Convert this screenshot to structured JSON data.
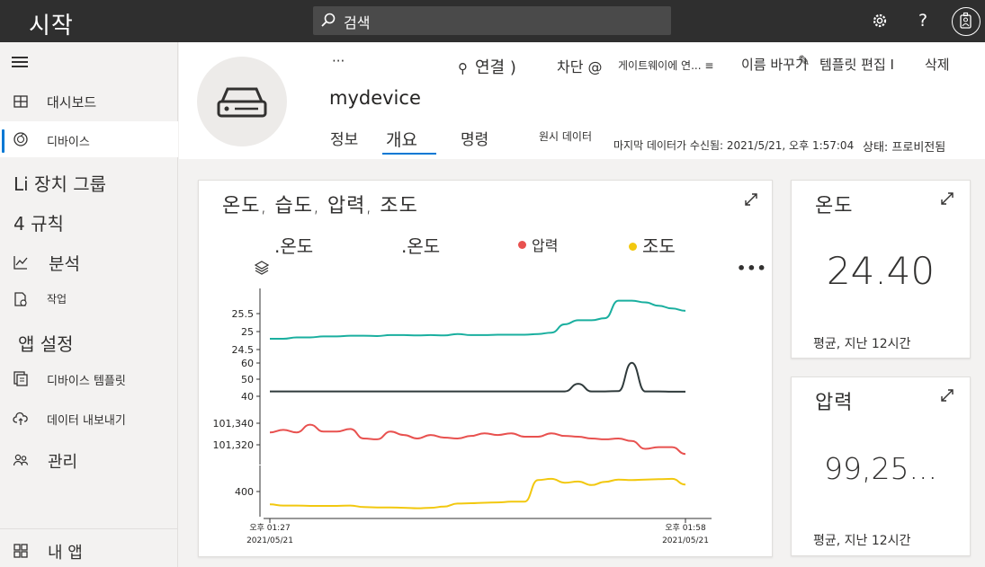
{
  "app": {
    "title": "시작"
  },
  "search": {
    "placeholder": "검색"
  },
  "sidebar": {
    "items": [
      {
        "label": "대시보드"
      },
      {
        "label": "디바이스"
      },
      {
        "label": "Li 장치 그룹"
      },
      {
        "label": "4 규칙"
      },
      {
        "label": "분석"
      },
      {
        "label": "작업"
      },
      {
        "label": "앱 설정"
      },
      {
        "label": "디바이스 템플릿"
      },
      {
        "label": "데이터 내보내기"
      },
      {
        "label": "관리"
      },
      {
        "label": "내 앱"
      }
    ]
  },
  "device": {
    "name": "mydevice",
    "commands": {
      "more": "···",
      "connect": "연결 )",
      "block": "차단 @",
      "gateway": "게이트웨이에 연... ≡",
      "rename": "이름 바꾸기",
      "edit_template": "템플릿 편집 I",
      "delete": "삭제"
    },
    "tabs": [
      {
        "label": "정보"
      },
      {
        "label": "개요"
      },
      {
        "label": "명령"
      },
      {
        "label": "원시 데이터"
      }
    ],
    "last_data": "마지막 데이터가 수신됨: 2021/5/21, 오후 1:57:04",
    "status": "상태: 프로비전됨"
  },
  "chart_card": {
    "title": "온도, 습도, 압력, 조도",
    "more_label": "•••",
    "chart_data": {
      "type": "line",
      "legend": [
        {
          "label": ".온도",
          "color": ""
        },
        {
          "label": ".온도",
          "color": ""
        },
        {
          "label": "압력",
          "color": "#e8514f"
        },
        {
          "label": "조도",
          "color": "#f2c80f"
        }
      ],
      "x_labels": [
        {
          "time": "오후 01:27",
          "date": "2021/05/21"
        },
        {
          "time": "오후 01:58",
          "date": "2021/05/21"
        }
      ],
      "series": [
        {
          "name": ".온도",
          "color": "#1aaf9f",
          "y_ticks": [
            "25.5",
            "25",
            "24.5"
          ],
          "ylim": [
            24.3,
            25.9
          ],
          "x": [
            0,
            1,
            2,
            3,
            4,
            5,
            6,
            7,
            8,
            9,
            10,
            11,
            12,
            13,
            14,
            15,
            16,
            17,
            18,
            19,
            20,
            21,
            22,
            23,
            24,
            25,
            26,
            27,
            28,
            29,
            30,
            31
          ],
          "values": [
            24.62,
            24.62,
            24.66,
            24.66,
            24.69,
            24.69,
            24.71,
            24.71,
            24.7,
            24.73,
            24.73,
            24.72,
            24.73,
            24.72,
            24.76,
            24.73,
            24.73,
            24.74,
            24.74,
            24.74,
            24.76,
            24.8,
            25.05,
            25.17,
            25.17,
            25.23,
            25.75,
            25.75,
            25.7,
            25.6,
            25.52,
            25.45
          ]
        },
        {
          "name": "",
          "color": "#2f3a3b",
          "y_ticks": [
            "60",
            "50",
            "40"
          ],
          "ylim": [
            30,
            64
          ],
          "x": [
            0,
            1,
            2,
            3,
            4,
            5,
            6,
            7,
            8,
            9,
            10,
            11,
            12,
            13,
            14,
            15,
            16,
            17,
            18,
            19,
            20,
            21,
            22,
            23,
            24,
            25,
            26,
            27,
            28,
            29,
            30,
            31
          ],
          "values": [
            39.5,
            39.5,
            39.5,
            39.5,
            39.5,
            39.5,
            39.5,
            39.5,
            39.5,
            39.5,
            39.5,
            39.5,
            39.5,
            39.5,
            39.5,
            39.5,
            39.5,
            39.5,
            39.5,
            39.5,
            39.5,
            39.5,
            39.5,
            45.5,
            39.5,
            39.5,
            39.8,
            62.0,
            39.5,
            39.5,
            39.3,
            39.3
          ]
        },
        {
          "name": "압력",
          "color": "#e8514f",
          "y_ticks": [
            "101,340",
            "101,320"
          ],
          "ylim": [
            101300,
            101350
          ],
          "x": [
            0,
            1,
            2,
            3,
            4,
            5,
            6,
            7,
            8,
            9,
            10,
            11,
            12,
            13,
            14,
            15,
            16,
            17,
            18,
            19,
            20,
            21,
            22,
            23,
            24,
            25,
            26,
            27,
            28,
            29,
            30,
            31
          ],
          "values": [
            101331,
            101334,
            101331,
            101340,
            101332,
            101332,
            101335,
            101324,
            101323,
            101332,
            101328,
            101324,
            101328,
            101325,
            101324,
            101327,
            101330,
            101328,
            101330,
            101326,
            101326,
            101330,
            101327,
            101326,
            101324,
            101323,
            101324,
            101321,
            101312,
            101314,
            101314,
            101306
          ]
        },
        {
          "name": "조도",
          "color": "#f2c80f",
          "y_ticks": [
            "400"
          ],
          "ylim": [
            370,
            470
          ],
          "x": [
            0,
            1,
            2,
            3,
            4,
            5,
            6,
            7,
            8,
            9,
            10,
            11,
            12,
            13,
            14,
            15,
            16,
            17,
            18,
            19,
            20,
            21,
            22,
            23,
            24,
            25,
            26,
            27,
            28,
            29,
            30,
            31
          ],
          "values": [
            388,
            385,
            385,
            384,
            384,
            384,
            385,
            381,
            380,
            380,
            379,
            378,
            379,
            382,
            390,
            391,
            392,
            393,
            395,
            395,
            451,
            454,
            444,
            447,
            438,
            446,
            452,
            451,
            452,
            453,
            454,
            439
          ]
        }
      ]
    }
  },
  "kpi_cards": [
    {
      "title": "온도",
      "value": "24.40",
      "footer": "평균, 지난 12시간"
    },
    {
      "title": "압력",
      "value": "99,25...",
      "footer": "평균, 지난 12시간"
    }
  ],
  "colors": {
    "accent": "#0078d4",
    "topbar": "#2f2f2f"
  }
}
